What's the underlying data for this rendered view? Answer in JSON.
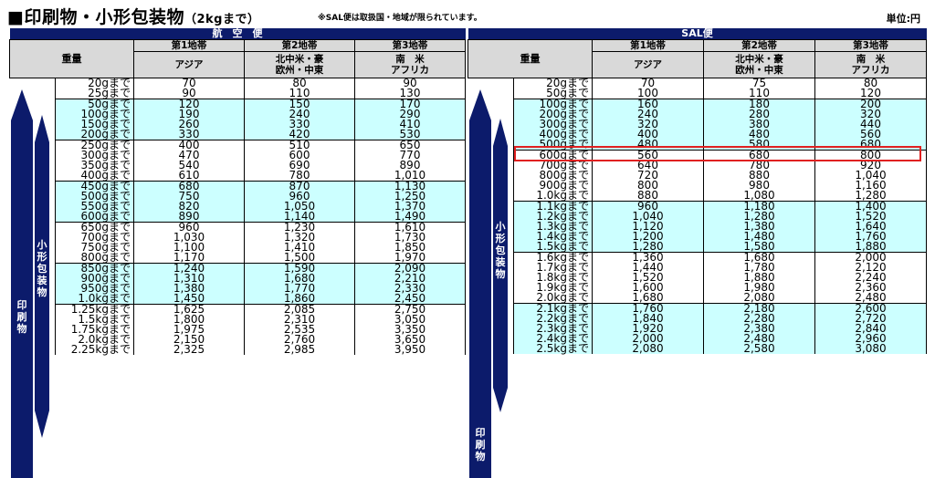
{
  "title": {
    "main": "■印刷物・小形包装物",
    "sub": "（2kgまで）"
  },
  "note": "※SAL便は取扱国・地域が限られています。",
  "unit": "単位:円",
  "air": {
    "section_label": "航　空　便",
    "weight_header": "重量",
    "zones": [
      {
        "name": "第1地帯",
        "region": "アジア"
      },
      {
        "name": "第2地帯",
        "region": "北中米・豪\n欧州・中東"
      },
      {
        "name": "第3地帯",
        "region": "南　米\nアフリカ"
      }
    ],
    "labels": {
      "small_packet": "小形包装物",
      "printed": "印刷物"
    },
    "rows": [
      {
        "w": "20gまで",
        "v": [
          "70",
          "80",
          "90"
        ]
      },
      {
        "w": "25gまで",
        "v": [
          "90",
          "110",
          "130"
        ]
      },
      {
        "w": "50gまで",
        "v": [
          "120",
          "150",
          "170"
        ]
      },
      {
        "w": "100gまで",
        "v": [
          "190",
          "240",
          "290"
        ]
      },
      {
        "w": "150gまで",
        "v": [
          "260",
          "330",
          "410"
        ]
      },
      {
        "w": "200gまで",
        "v": [
          "330",
          "420",
          "530"
        ]
      },
      {
        "w": "250gまで",
        "v": [
          "400",
          "510",
          "650"
        ]
      },
      {
        "w": "300gまで",
        "v": [
          "470",
          "600",
          "770"
        ]
      },
      {
        "w": "350gまで",
        "v": [
          "540",
          "690",
          "890"
        ]
      },
      {
        "w": "400gまで",
        "v": [
          "610",
          "780",
          "1,010"
        ]
      },
      {
        "w": "450gまで",
        "v": [
          "680",
          "870",
          "1,130"
        ]
      },
      {
        "w": "500gまで",
        "v": [
          "750",
          "960",
          "1,250"
        ]
      },
      {
        "w": "550gまで",
        "v": [
          "820",
          "1,050",
          "1,370"
        ]
      },
      {
        "w": "600gまで",
        "v": [
          "890",
          "1,140",
          "1,490"
        ]
      },
      {
        "w": "650gまで",
        "v": [
          "960",
          "1,230",
          "1,610"
        ]
      },
      {
        "w": "700gまで",
        "v": [
          "1,030",
          "1,320",
          "1,730"
        ]
      },
      {
        "w": "750gまで",
        "v": [
          "1,100",
          "1,410",
          "1,850"
        ]
      },
      {
        "w": "800gまで",
        "v": [
          "1,170",
          "1,500",
          "1,970"
        ]
      },
      {
        "w": "850gまで",
        "v": [
          "1,240",
          "1,590",
          "2,090"
        ]
      },
      {
        "w": "900gまで",
        "v": [
          "1,310",
          "1,680",
          "2,210"
        ]
      },
      {
        "w": "950gまで",
        "v": [
          "1,380",
          "1,770",
          "2,330"
        ]
      },
      {
        "w": "1.0kgまで",
        "v": [
          "1,450",
          "1,860",
          "2,450"
        ]
      },
      {
        "w": "1.25kgまで",
        "v": [
          "1,625",
          "2,085",
          "2,750"
        ]
      },
      {
        "w": "1.5kgまで",
        "v": [
          "1,800",
          "2,310",
          "3,050"
        ]
      },
      {
        "w": "1.75kgまで",
        "v": [
          "1,975",
          "2,535",
          "3,350"
        ]
      },
      {
        "w": "2.0kgまで",
        "v": [
          "2,150",
          "2,760",
          "3,650"
        ]
      },
      {
        "w": "2.25kgまで",
        "v": [
          "2,325",
          "2,985",
          "3,950"
        ]
      }
    ]
  },
  "sal": {
    "section_label": "SAL便",
    "weight_header": "重量",
    "zones": [
      {
        "name": "第1地帯",
        "region": "アジア"
      },
      {
        "name": "第2地帯",
        "region": "北中米・豪\n欧州・中東"
      },
      {
        "name": "第3地帯",
        "region": "南　米\nアフリカ"
      }
    ],
    "labels": {
      "small_packet": "小形包装物",
      "printed": "印刷物"
    },
    "rows": [
      {
        "w": "20gまで",
        "v": [
          "70",
          "75",
          "80"
        ]
      },
      {
        "w": "50gまで",
        "v": [
          "100",
          "110",
          "120"
        ]
      },
      {
        "w": "100gまで",
        "v": [
          "160",
          "180",
          "200"
        ]
      },
      {
        "w": "200gまで",
        "v": [
          "240",
          "280",
          "320"
        ]
      },
      {
        "w": "300gまで",
        "v": [
          "320",
          "380",
          "440"
        ]
      },
      {
        "w": "400gまで",
        "v": [
          "400",
          "480",
          "560"
        ]
      },
      {
        "w": "500gまで",
        "v": [
          "480",
          "580",
          "680"
        ]
      },
      {
        "w": "600gまで",
        "v": [
          "560",
          "680",
          "800"
        ]
      },
      {
        "w": "700gまで",
        "v": [
          "640",
          "780",
          "920"
        ]
      },
      {
        "w": "800gまで",
        "v": [
          "720",
          "880",
          "1,040"
        ]
      },
      {
        "w": "900gまで",
        "v": [
          "800",
          "980",
          "1,160"
        ]
      },
      {
        "w": "1.0kgまで",
        "v": [
          "880",
          "1,080",
          "1,280"
        ]
      },
      {
        "w": "1.1kgまで",
        "v": [
          "960",
          "1,180",
          "1,400"
        ]
      },
      {
        "w": "1.2kgまで",
        "v": [
          "1,040",
          "1,280",
          "1,520"
        ]
      },
      {
        "w": "1.3kgまで",
        "v": [
          "1,120",
          "1,380",
          "1,640"
        ]
      },
      {
        "w": "1.4kgまで",
        "v": [
          "1,200",
          "1,480",
          "1,760"
        ]
      },
      {
        "w": "1.5kgまで",
        "v": [
          "1,280",
          "1,580",
          "1,880"
        ]
      },
      {
        "w": "1.6kgまで",
        "v": [
          "1,360",
          "1,680",
          "2,000"
        ]
      },
      {
        "w": "1.7kgまで",
        "v": [
          "1,440",
          "1,780",
          "2,120"
        ]
      },
      {
        "w": "1.8kgまで",
        "v": [
          "1,520",
          "1,880",
          "2,240"
        ]
      },
      {
        "w": "1.9kgまで",
        "v": [
          "1,600",
          "1,980",
          "2,360"
        ]
      },
      {
        "w": "2.0kgまで",
        "v": [
          "1,680",
          "2,080",
          "2,480"
        ]
      },
      {
        "w": "2.1kgまで",
        "v": [
          "1,760",
          "2,180",
          "2,600"
        ]
      },
      {
        "w": "2.2kgまで",
        "v": [
          "1,840",
          "2,280",
          "2,720"
        ]
      },
      {
        "w": "2.3kgまで",
        "v": [
          "1,920",
          "2,380",
          "2,840"
        ]
      },
      {
        "w": "2.4kgまで",
        "v": [
          "2,000",
          "2,480",
          "2,960"
        ]
      },
      {
        "w": "2.5kgまで",
        "v": [
          "2,080",
          "2,580",
          "3,080"
        ]
      }
    ]
  }
}
